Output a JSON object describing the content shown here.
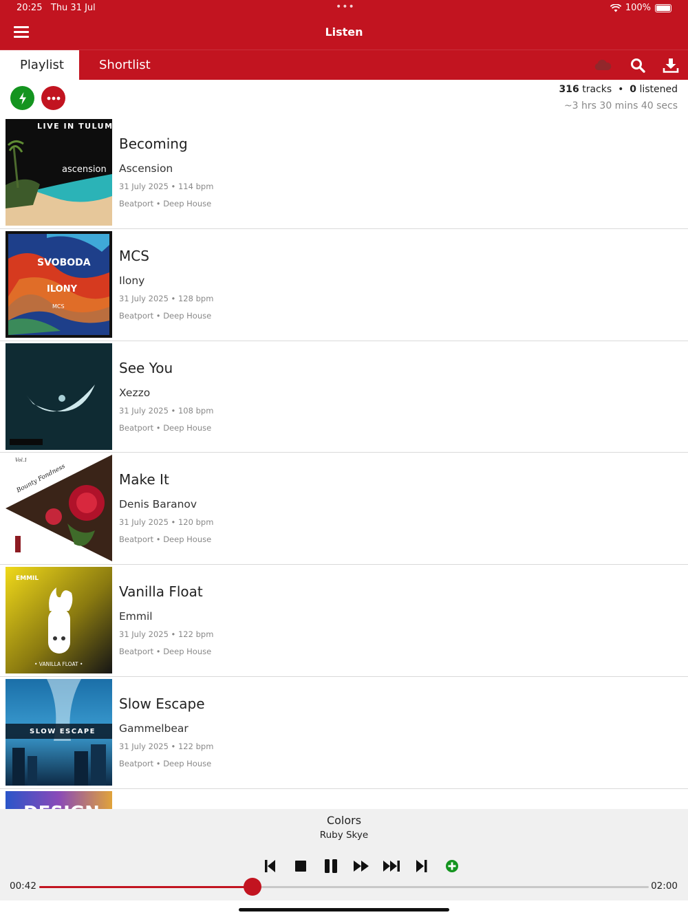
{
  "status": {
    "time": "20:25",
    "date": "Thu 31 Jul",
    "battery": "100%"
  },
  "header": {
    "title": "Listen"
  },
  "tabs": [
    {
      "label": "Playlist",
      "active": true
    },
    {
      "label": "Shortlist",
      "active": false
    }
  ],
  "toolbar": {
    "icons": [
      "cloud-icon",
      "search-icon",
      "download-icon"
    ]
  },
  "actions": {
    "left": [
      "lightning-icon",
      "more-icon"
    ]
  },
  "stats": {
    "tracks": "316",
    "tracks_label": "tracks",
    "listened": "0",
    "listened_label": "listened",
    "duration": "~3 hrs 30 mins 40 secs"
  },
  "tracks": [
    {
      "title": "Becoming",
      "artist": "Ascension",
      "meta": "31 July 2025 • 114 bpm",
      "tags": "Beatport • Deep House",
      "art_text": "LIVE IN TULUM",
      "art_sub": "ascension"
    },
    {
      "title": "MCS",
      "artist": "Ilony",
      "meta": "31 July 2025 • 128 bpm",
      "tags": "Beatport • Deep House",
      "art_text": "SVOBODA",
      "art_sub": "ILONY",
      "art_sub2": "MCS"
    },
    {
      "title": "See You",
      "artist": "Xezzo",
      "meta": "31 July 2025 • 108 bpm",
      "tags": "Beatport • Deep House"
    },
    {
      "title": "Make It",
      "artist": "Denis Baranov",
      "meta": "31 July 2025 • 120 bpm",
      "tags": "Beatport • Deep House",
      "art_text": "Bounty Fondness",
      "art_sub": "Vol.1"
    },
    {
      "title": "Vanilla Float",
      "artist": "Emmil",
      "meta": "31 July 2025 • 122 bpm",
      "tags": "Beatport • Deep House",
      "art_text": "EMMIL",
      "art_sub": "• VANILLA FLOAT •"
    },
    {
      "title": "Slow Escape",
      "artist": "Gammelbear",
      "meta": "31 July 2025 • 122 bpm",
      "tags": "Beatport • Deep House",
      "art_text": "SLOW ESCAPE"
    },
    {
      "title": "",
      "artist": "",
      "meta": "",
      "tags": "",
      "art_text": "DESIGN"
    }
  ],
  "player": {
    "title": "Colors",
    "artist": "Ruby Skye",
    "elapsed": "00:42",
    "total": "02:00",
    "progress": 0.35,
    "controls": [
      "skip-previous-icon",
      "stop-icon",
      "pause-icon",
      "fast-forward-icon",
      "skip-next-icon",
      "skip-end-icon",
      "add-circle-icon"
    ]
  },
  "colors": {
    "brand": "#c21420",
    "green": "#14941f",
    "player_bg": "#f0f0f0"
  }
}
